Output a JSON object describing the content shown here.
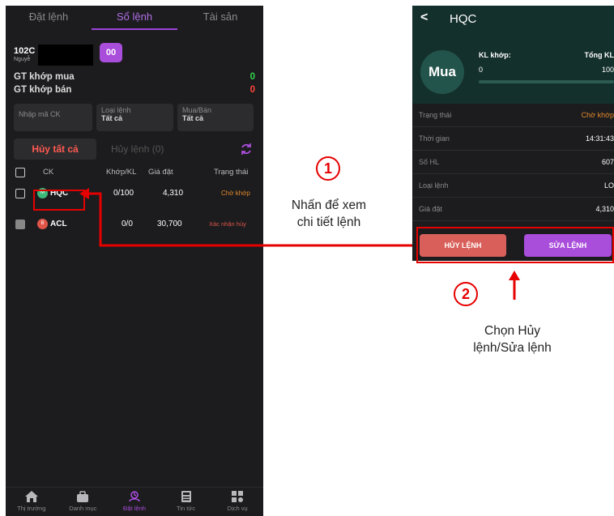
{
  "left": {
    "tabs": [
      "Đặt lệnh",
      "Sổ lệnh",
      "Tài sản"
    ],
    "account": {
      "number": "102C",
      "name": "Nguyễ",
      "badge": "00"
    },
    "gt_buy": {
      "label": "GT khớp mua",
      "value": "0"
    },
    "gt_sell": {
      "label": "GT khớp bán",
      "value": "0"
    },
    "filters": {
      "symbol_placeholder": "Nhập mã CK",
      "order_type_label": "Loại lệnh",
      "order_type_value": "Tất cả",
      "side_label": "Mua/Bán",
      "side_value": "Tất cả"
    },
    "cancel_all": "Hủy tất cả",
    "cancel_count": "Hủy lệnh (0)",
    "columns": {
      "symbol": "CK",
      "matched": "Khớp/KL",
      "price": "Giá đặt",
      "status": "Trạng thái"
    },
    "rows": [
      {
        "badge": "M",
        "badge_color": "#3cb878",
        "symbol": "HQC",
        "matched": "0/100",
        "price": "4,310",
        "status": "Chờ khớp",
        "status_color": "#e38a2a"
      },
      {
        "badge": "B",
        "badge_color": "#e05548",
        "symbol": "ACL",
        "matched": "0/0",
        "price": "30,700",
        "status": "Xác nhận hủy",
        "status_color": "#e05548"
      }
    ],
    "nav": [
      "Thị trường",
      "Danh mục",
      "Đặt lệnh",
      "Tin tức",
      "Dịch vụ"
    ]
  },
  "annotations": {
    "step1": "1",
    "note1_line1": "Nhấn để xem",
    "note1_line2": "chi tiết lệnh",
    "step2": "2",
    "note2_line1": "Chọn Hủy",
    "note2_line2": "lệnh/Sửa lệnh"
  },
  "right": {
    "title": "HQC",
    "side": "Mua",
    "kl_label": "KL khớp:",
    "kl_value": "0",
    "total_label": "Tổng KL",
    "total_value": "100",
    "progress": 0,
    "details": [
      {
        "key": "Trạng thái",
        "value": "Chờ khớp",
        "highlight": true
      },
      {
        "key": "Thời gian",
        "value": "14:31:43"
      },
      {
        "key": "Số HL",
        "value": "607"
      },
      {
        "key": "Loại lệnh",
        "value": "LO"
      },
      {
        "key": "Giá đặt",
        "value": "4,310"
      }
    ],
    "btn_cancel": "HỦY LỆNH",
    "btn_edit": "SỬA LỆNH"
  },
  "colors": {
    "accent": "#a94ddb",
    "warning": "#e38a2a",
    "danger": "#e60000",
    "header_green": "#14302c"
  }
}
